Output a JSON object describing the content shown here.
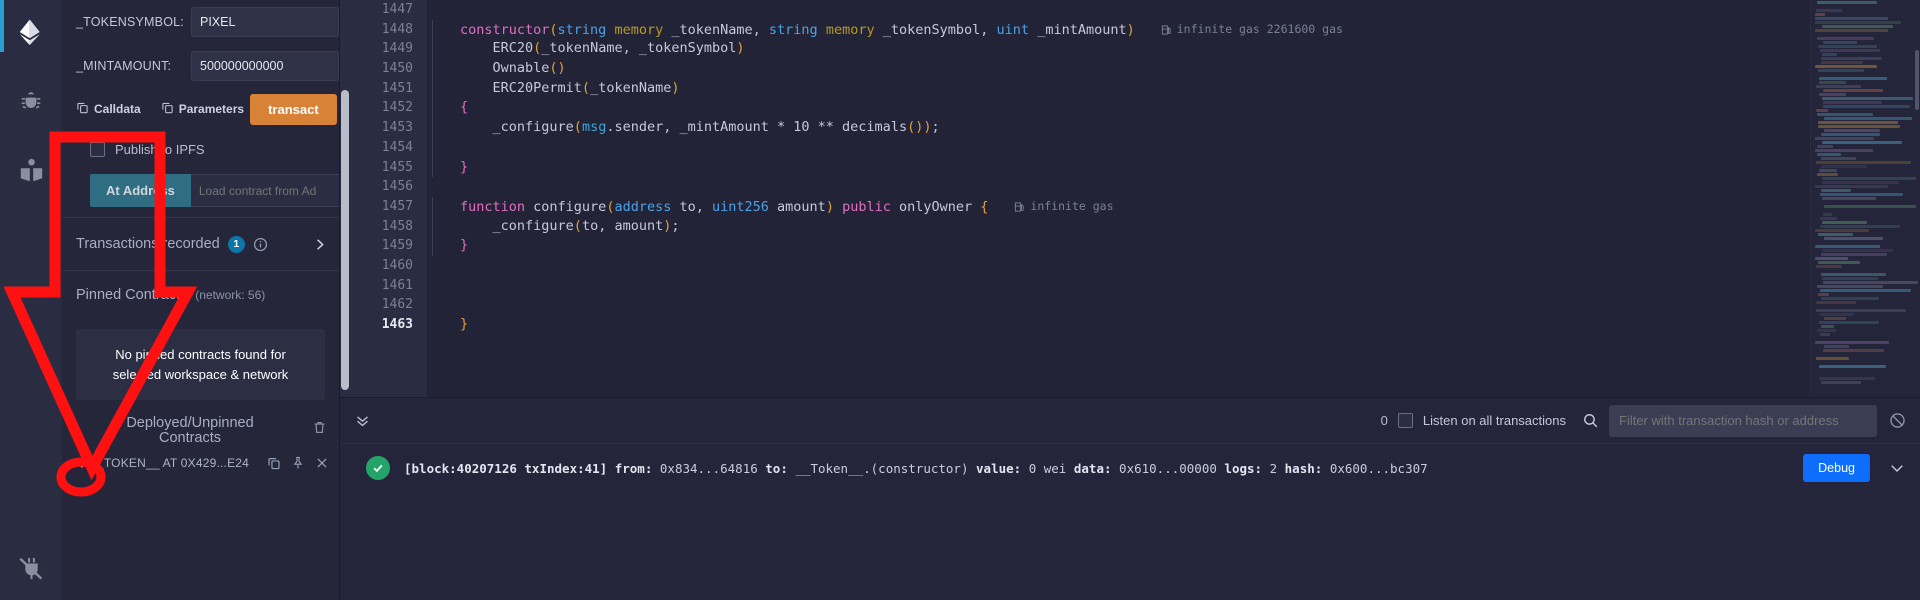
{
  "rail": {
    "items": [
      {
        "name": "ethereum-logo-icon",
        "label": "Deploy & Run"
      },
      {
        "name": "bug-debugger-icon",
        "label": "Debugger"
      },
      {
        "name": "book-library-icon",
        "label": "Documentation"
      }
    ],
    "bottom": {
      "name": "plugin-manager-icon",
      "label": "Plugin Manager"
    }
  },
  "deploy": {
    "fields": [
      {
        "label": "_TOKENSYMBOL:",
        "value": "PIXEL"
      },
      {
        "label": "_MINTAMOUNT:",
        "value": "500000000000"
      }
    ],
    "calldata_label": "Calldata",
    "parameters_label": "Parameters",
    "transact_label": "transact",
    "ipfs_label": "Publish to IPFS",
    "at_address_label": "At Address",
    "load_contract_placeholder": "Load contract from Ad",
    "transactions_recorded": {
      "title": "Transactions recorded",
      "count": "1"
    },
    "pinned": {
      "title": "Pinned Contracts",
      "network": "(network: 56)",
      "empty_line1": "No pinned contracts found for",
      "empty_line2": "selected workspace & network"
    },
    "deployed": {
      "title_line1": "Deployed/Unpinned",
      "title_line2": "Contracts",
      "items": [
        {
          "label": "_TOKEN__ AT 0X429...E24"
        }
      ]
    }
  },
  "editor": {
    "lines": [
      {
        "num": "1447",
        "tokens": []
      },
      {
        "num": "1448",
        "tokens": [
          {
            "t": "constructor",
            "c": "kw"
          },
          {
            "t": "(",
            "c": "brace"
          },
          {
            "t": "string",
            "c": "typ"
          },
          {
            "t": " ",
            "c": "fn"
          },
          {
            "t": "memory",
            "c": "mem"
          },
          {
            "t": " _tokenName, ",
            "c": "fn"
          },
          {
            "t": "string",
            "c": "typ"
          },
          {
            "t": " ",
            "c": "fn"
          },
          {
            "t": "memory",
            "c": "mem"
          },
          {
            "t": " _tokenSymbol, ",
            "c": "fn"
          },
          {
            "t": "uint",
            "c": "typ"
          },
          {
            "t": " _mintAmount",
            "c": "fn"
          },
          {
            "t": ")",
            "c": "brace"
          }
        ],
        "indent": 8,
        "gas": "infinite gas 2261600 gas"
      },
      {
        "num": "1449",
        "tokens": [
          {
            "t": "    ERC20",
            "c": "fn"
          },
          {
            "t": "(",
            "c": "brace"
          },
          {
            "t": "_tokenName, _tokenSymbol",
            "c": "fn"
          },
          {
            "t": ")",
            "c": "brace"
          }
        ],
        "indent": 8
      },
      {
        "num": "1450",
        "tokens": [
          {
            "t": "    Ownable",
            "c": "fn"
          },
          {
            "t": "()",
            "c": "brace"
          }
        ],
        "indent": 8
      },
      {
        "num": "1451",
        "tokens": [
          {
            "t": "    ERC20Permit",
            "c": "fn"
          },
          {
            "t": "(",
            "c": "brace"
          },
          {
            "t": "_tokenName",
            "c": "fn"
          },
          {
            "t": ")",
            "c": "brace"
          }
        ],
        "indent": 8
      },
      {
        "num": "1452",
        "tokens": [
          {
            "t": "{",
            "c": "kw"
          }
        ],
        "indent": 8
      },
      {
        "num": "1453",
        "tokens": [
          {
            "t": "    _configure",
            "c": "fn"
          },
          {
            "t": "(",
            "c": "brace"
          },
          {
            "t": "msg",
            "c": "obj"
          },
          {
            "t": ".sender, _mintAmount * ",
            "c": "fn"
          },
          {
            "t": "10",
            "c": "num"
          },
          {
            "t": " ** ",
            "c": "fn"
          },
          {
            "t": "decimals",
            "c": "fn"
          },
          {
            "t": "())",
            "c": "brace"
          },
          {
            "t": ";",
            "c": "fn"
          }
        ],
        "indent": 8
      },
      {
        "num": "1454",
        "tokens": [],
        "indent": 8
      },
      {
        "num": "1455",
        "tokens": [
          {
            "t": "}",
            "c": "kw"
          }
        ],
        "indent": 8
      },
      {
        "num": "1456",
        "tokens": []
      },
      {
        "num": "1457",
        "tokens": [
          {
            "t": "function",
            "c": "kw"
          },
          {
            "t": " configure",
            "c": "fn"
          },
          {
            "t": "(",
            "c": "brace"
          },
          {
            "t": "address",
            "c": "typ"
          },
          {
            "t": " to, ",
            "c": "fn"
          },
          {
            "t": "uint256",
            "c": "typ"
          },
          {
            "t": " amount",
            "c": "fn"
          },
          {
            "t": ") ",
            "c": "brace"
          },
          {
            "t": "public",
            "c": "kw"
          },
          {
            "t": " onlyOwner ",
            "c": "fn"
          },
          {
            "t": "{",
            "c": "brace"
          }
        ],
        "indent": 8,
        "gas": "infinite gas"
      },
      {
        "num": "1458",
        "tokens": [
          {
            "t": "    _configure",
            "c": "fn"
          },
          {
            "t": "(",
            "c": "brace"
          },
          {
            "t": "to, amount",
            "c": "fn"
          },
          {
            "t": ")",
            "c": "brace"
          },
          {
            "t": ";",
            "c": "fn"
          }
        ],
        "indent": 8
      },
      {
        "num": "1459",
        "tokens": [
          {
            "t": "}",
            "c": "kw"
          }
        ],
        "indent": 8
      },
      {
        "num": "1460",
        "tokens": []
      },
      {
        "num": "1461",
        "tokens": []
      },
      {
        "num": "1462",
        "tokens": []
      },
      {
        "num": "1463",
        "tokens": [
          {
            "t": "}",
            "c": "brace"
          }
        ],
        "current": true
      }
    ]
  },
  "terminal": {
    "pending_count": "0",
    "listen_label": "Listen on all transactions",
    "filter_placeholder": "Filter with transaction hash or address",
    "transaction": {
      "status": "success",
      "block_label": "[block:40207126 txIndex:41]",
      "from_label": "from:",
      "from_value": "0x834...64816",
      "to_label": "to:",
      "to_value": "__Token__.(constructor)",
      "value_label": "value:",
      "value_value": "0 wei",
      "data_label": "data:",
      "data_value": "0x610...00000",
      "logs_label": "logs:",
      "logs_value": "2",
      "hash_label": "hash:",
      "hash_value": "0x600...bc307",
      "debug_label": "Debug"
    }
  },
  "annotation": {
    "color": "#ff1111",
    "shape": "down-arrow-pointing-to-deployed-contract"
  }
}
